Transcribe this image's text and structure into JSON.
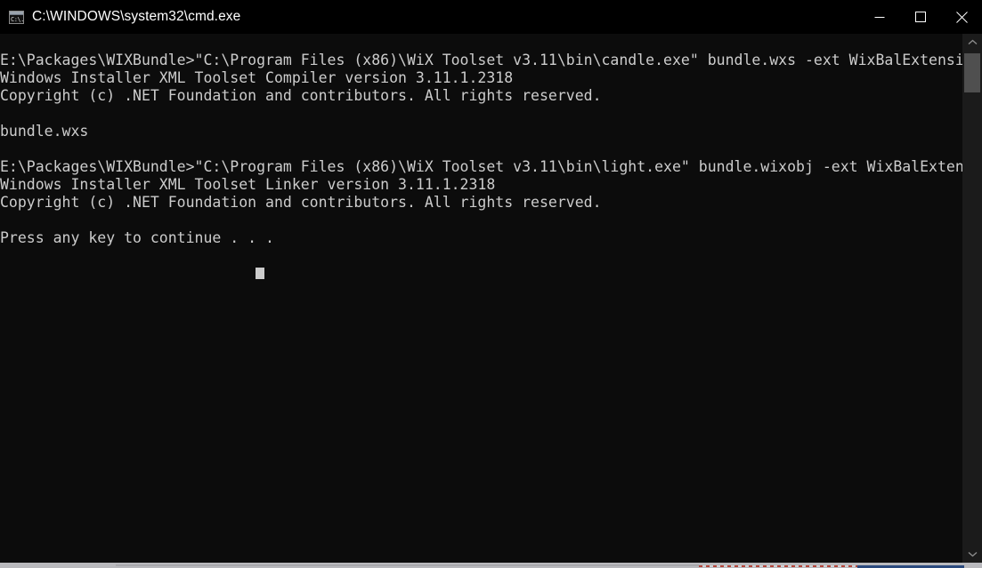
{
  "window": {
    "title": "C:\\WINDOWS\\system32\\cmd.exe",
    "icon": "console-icon",
    "icon_glyph": "C:\\.",
    "background_color": "#0c0c0c",
    "titlebar_color": "#000000",
    "text_color": "#cccccc"
  },
  "controls": {
    "minimize_label": "Minimize",
    "maximize_label": "Maximize",
    "close_label": "Close"
  },
  "console": {
    "lines": [
      "E:\\Packages\\WIXBundle>\"C:\\Program Files (x86)\\WiX Toolset v3.11\\bin\\candle.exe\" bundle.wxs -ext WixBalExtension",
      "Windows Installer XML Toolset Compiler version 3.11.1.2318",
      "Copyright (c) .NET Foundation and contributors. All rights reserved.",
      "",
      "bundle.wxs",
      "",
      "E:\\Packages\\WIXBundle>\"C:\\Program Files (x86)\\WiX Toolset v3.11\\bin\\light.exe\" bundle.wixobj -ext WixBalExtension",
      "Windows Installer XML Toolset Linker version 3.11.1.2318",
      "Copyright (c) .NET Foundation and contributors. All rights reserved.",
      "",
      "Press any key to continue . . ."
    ],
    "cursor": "block"
  },
  "scrollbar": {
    "up_arrow": "chevron-up-icon",
    "down_arrow": "chevron-down-icon",
    "thumb_position_percent": 4
  }
}
